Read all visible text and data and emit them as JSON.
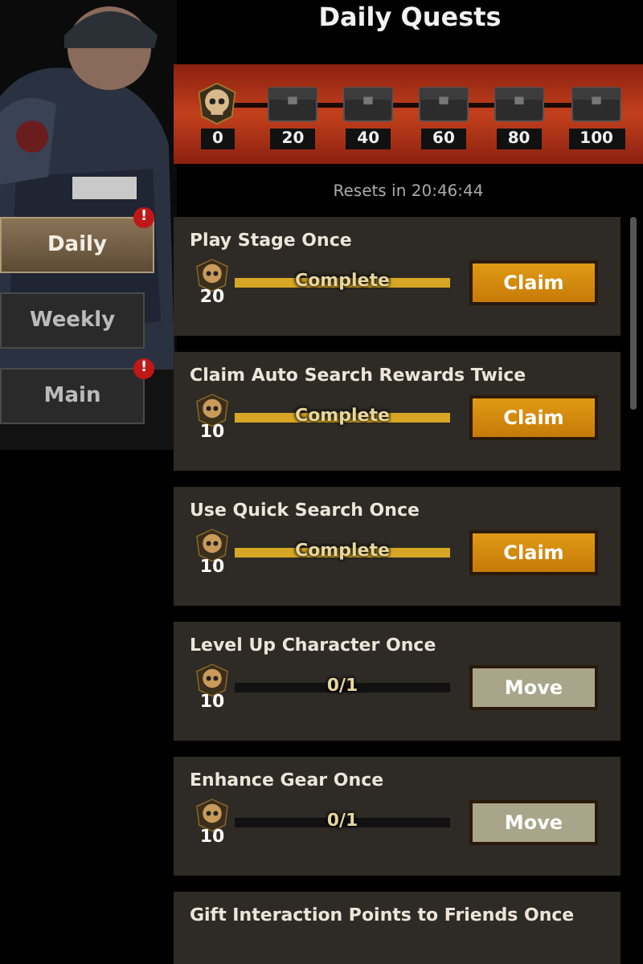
{
  "title": "Daily Quests",
  "milestones": [
    {
      "kind": "skull",
      "label": "0"
    },
    {
      "kind": "chest",
      "label": "20"
    },
    {
      "kind": "chest",
      "label": "40"
    },
    {
      "kind": "chest",
      "label": "60"
    },
    {
      "kind": "chest",
      "label": "80"
    },
    {
      "kind": "chest",
      "label": "100"
    }
  ],
  "reset_text": "Resets in 20:46:44",
  "tabs": [
    {
      "label": "Daily",
      "selected": true,
      "alert": "!"
    },
    {
      "label": "Weekly",
      "selected": false
    },
    {
      "label": "Main",
      "selected": false,
      "alert": "!"
    }
  ],
  "quests": [
    {
      "title": "Play Stage Once",
      "reward": "20",
      "level": 1,
      "progress": "Complete",
      "button": {
        "kind": "claim",
        "label": "Claim"
      }
    },
    {
      "title": "Claim Auto Search Rewards Twice",
      "reward": "10",
      "level": 1,
      "progress": "Complete",
      "button": {
        "kind": "claim",
        "label": "Claim"
      }
    },
    {
      "title": "Use Quick Search Once",
      "reward": "10",
      "level": 1,
      "progress": "Complete",
      "button": {
        "kind": "claim",
        "label": "Claim"
      }
    },
    {
      "title": "Level Up Character Once",
      "reward": "10",
      "level": 0,
      "progress": "0/1",
      "button": {
        "kind": "move",
        "label": "Move"
      }
    },
    {
      "title": "Enhance Gear Once",
      "reward": "10",
      "level": 0,
      "progress": "0/1",
      "button": {
        "kind": "move",
        "label": "Move"
      }
    },
    {
      "title": "Gift Interaction Points to Friends Once"
    }
  ]
}
